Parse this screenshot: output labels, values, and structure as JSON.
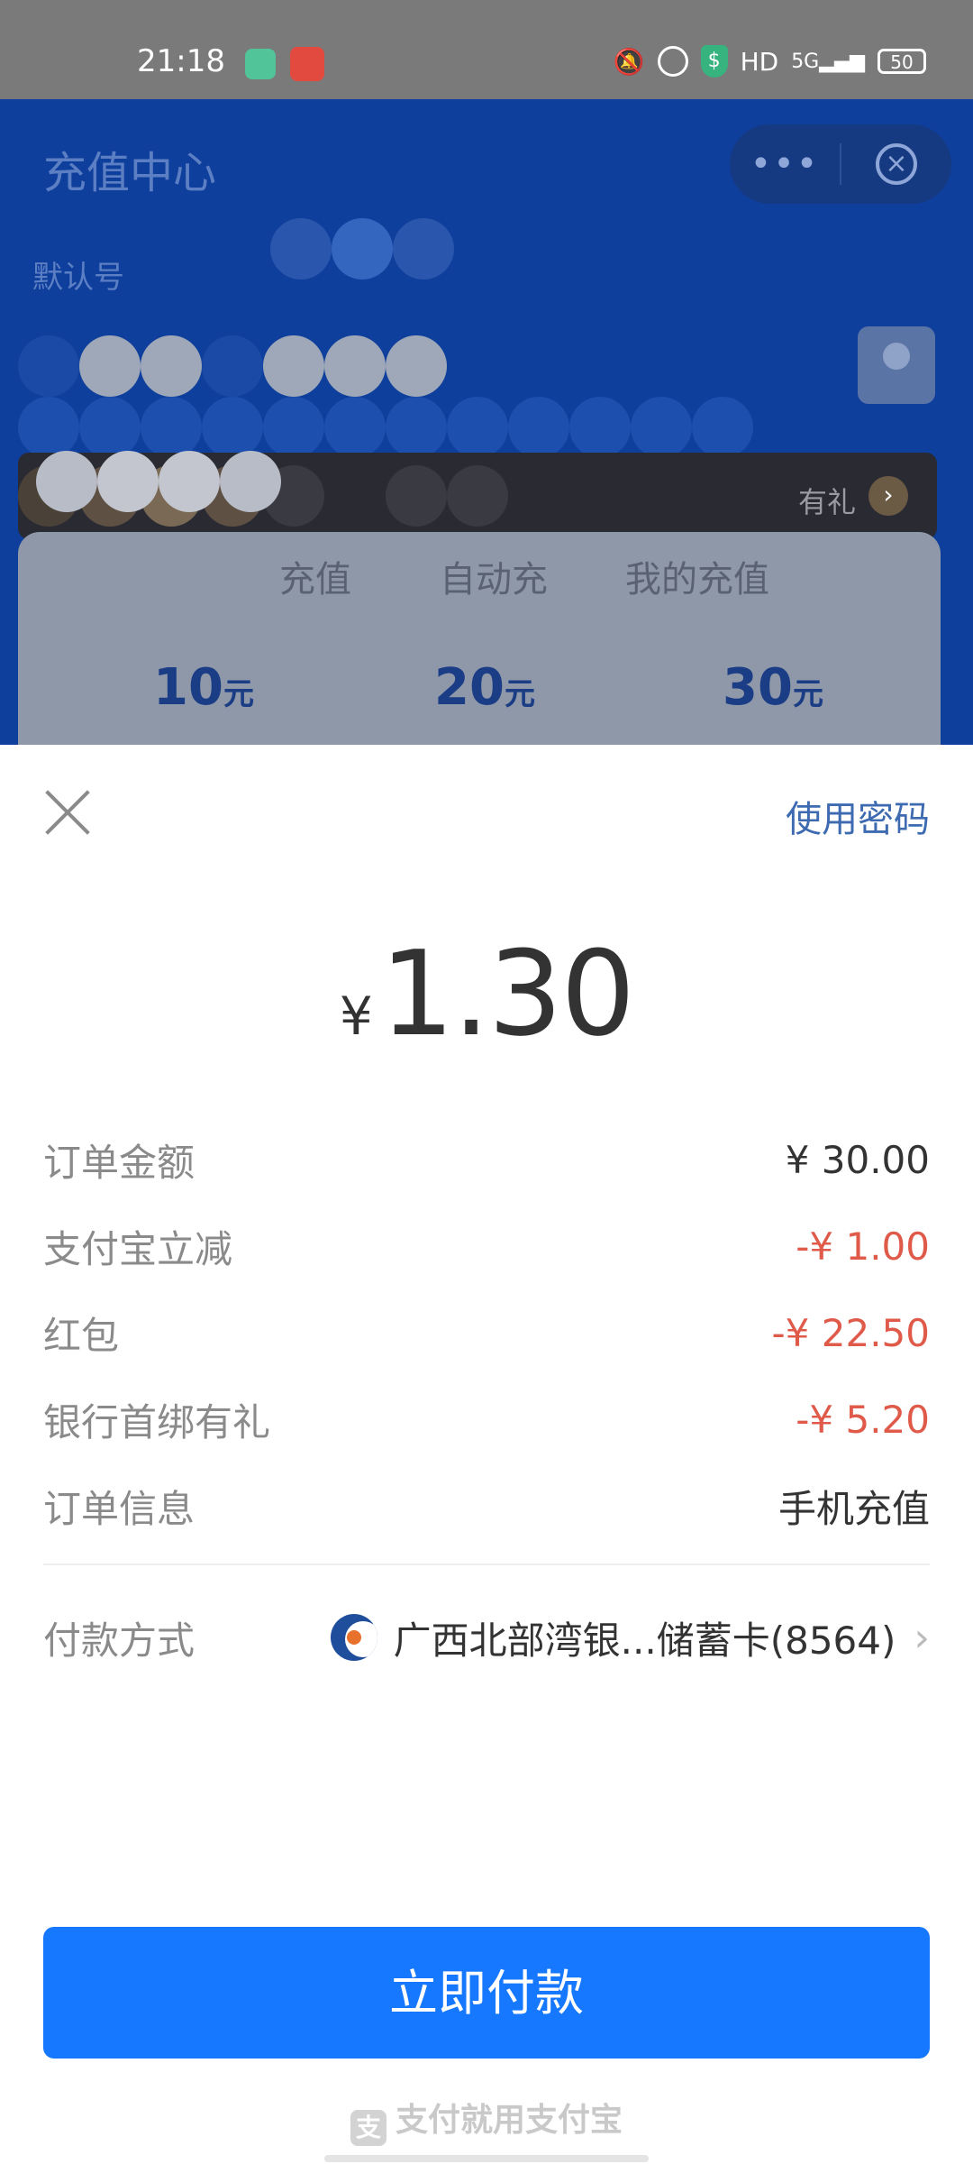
{
  "status_bar": {
    "time": "21:18",
    "network": "HD",
    "signal": "5G",
    "battery": "50"
  },
  "background_app": {
    "title": "充值中心",
    "default_label": "默认号",
    "banner_text": "有礼",
    "tabs": [
      "充值",
      "自动充",
      "我的充值"
    ],
    "amounts": [
      {
        "value": "10",
        "unit": "元"
      },
      {
        "value": "20",
        "unit": "元"
      },
      {
        "value": "30",
        "unit": "元"
      }
    ]
  },
  "sheet": {
    "use_password": "使用密码",
    "currency_symbol": "¥",
    "amount": "1.30",
    "rows": [
      {
        "label": "订单金额",
        "value": "¥ 30.00",
        "red": false
      },
      {
        "label": "支付宝立减",
        "value": "-¥ 1.00",
        "red": true
      },
      {
        "label": "红包",
        "value": "-¥ 22.50",
        "red": true
      },
      {
        "label": "银行首绑有礼",
        "value": "-¥ 5.20",
        "red": true
      },
      {
        "label": "订单信息",
        "value": "手机充值",
        "red": false
      }
    ],
    "payment_method": {
      "label": "付款方式",
      "bank": "广西北部湾银...储蓄卡(8564)"
    },
    "pay_button": "立即付款",
    "footer": "支付就用支付宝",
    "footer_logo": "支"
  },
  "colors": {
    "primary": "#1677ff",
    "discount_red": "#e05a4a",
    "label_gray": "#8a8a8a",
    "link_blue": "#3d6ab0"
  }
}
